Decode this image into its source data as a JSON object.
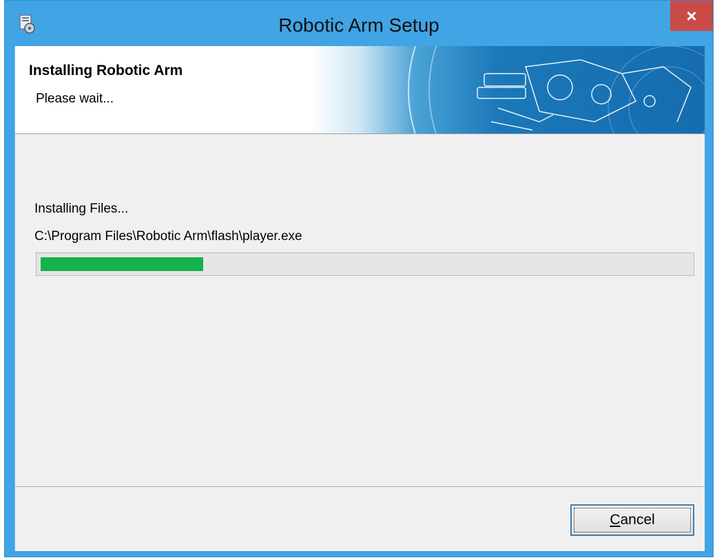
{
  "window": {
    "title": "Robotic Arm Setup",
    "close_glyph": "×",
    "accent_color": "#41a4e4",
    "close_color": "#c94b47"
  },
  "app_icon": "setup-disk-icon",
  "header": {
    "title": "Installing Robotic Arm",
    "subtitle": "Please wait...",
    "art": "robotic-arm-illustration"
  },
  "body": {
    "status": "Installing Files...",
    "current_file": "C:\\Program Files\\Robotic Arm\\flash\\player.exe",
    "progress_percent": 25,
    "progress_color": "#16b14a"
  },
  "footer": {
    "cancel_accesskey": "C",
    "cancel_rest": "ancel"
  }
}
